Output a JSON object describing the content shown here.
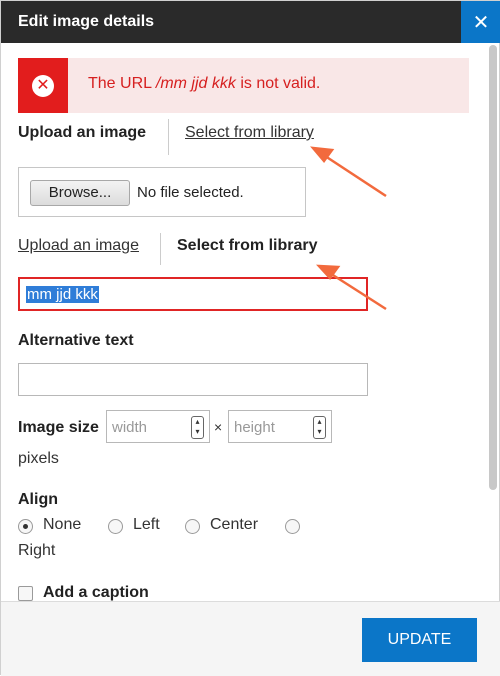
{
  "dialog": {
    "title": "Edit image details",
    "close_icon": "close-icon",
    "close_label": "✕"
  },
  "error": {
    "icon": "error-x-icon",
    "icon_glyph": "✕",
    "prefix": "The URL ",
    "url": "/mm jjd kkk",
    "suffix": " is not valid.",
    "color": "#d62020"
  },
  "upload_tabs": {
    "upload_label": "Upload an image",
    "library_label": "Select from library"
  },
  "file_picker": {
    "browse_label": "Browse...",
    "status": "No file selected."
  },
  "library_tabs": {
    "upload_label": "Upload an image",
    "library_label": "Select from library"
  },
  "url_input": {
    "value": "mm jjd kkk"
  },
  "alt_text": {
    "label": "Alternative text",
    "value": ""
  },
  "image_size": {
    "label": "Image size",
    "width_placeholder": "width",
    "height_placeholder": "height",
    "separator": "×",
    "unit": "pixels"
  },
  "align": {
    "label": "Align",
    "options": [
      "None",
      "Left",
      "Center",
      "Right"
    ],
    "selected": "None"
  },
  "caption": {
    "label": "Add a caption",
    "checked": false
  },
  "footer": {
    "update_label": "UPDATE"
  },
  "colors": {
    "accent": "#0b76c8",
    "error_bg": "#f9e7e7",
    "error_red": "#e21d1d",
    "annotation_arrow": "#f26a3d"
  }
}
